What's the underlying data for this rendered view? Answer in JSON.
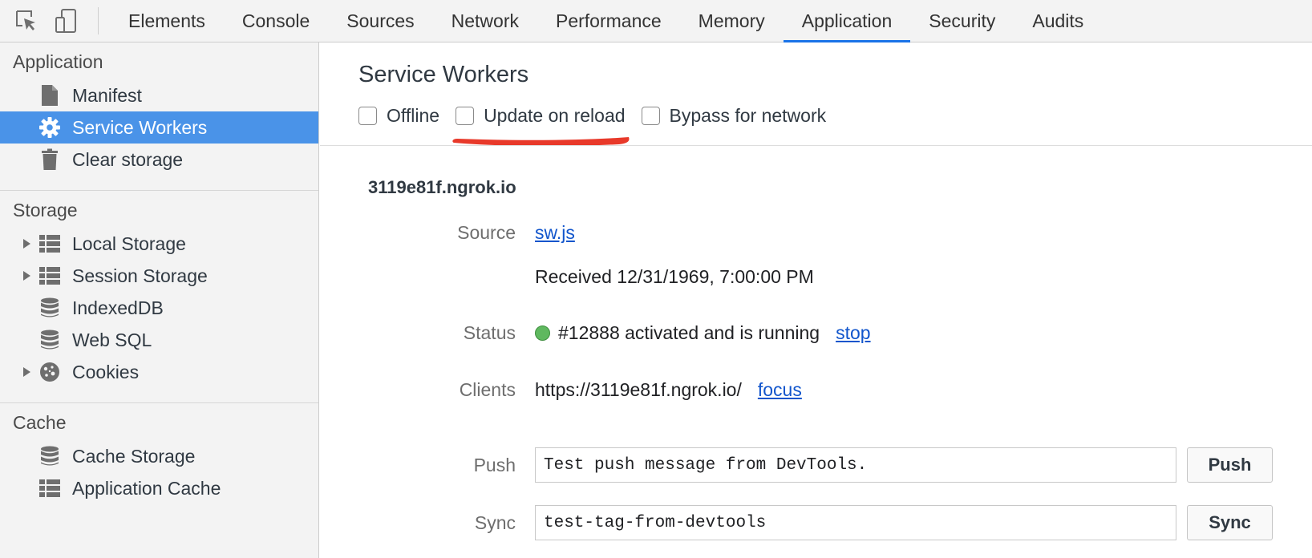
{
  "toolbar": {
    "icons": {
      "inspect": "inspect-element-icon",
      "device": "device-toolbar-icon"
    },
    "tabs": [
      {
        "label": "Elements"
      },
      {
        "label": "Console"
      },
      {
        "label": "Sources"
      },
      {
        "label": "Network"
      },
      {
        "label": "Performance"
      },
      {
        "label": "Memory"
      },
      {
        "label": "Application",
        "active": true
      },
      {
        "label": "Security"
      },
      {
        "label": "Audits"
      }
    ],
    "accent": "#1a73e8"
  },
  "sidebar": {
    "sections": [
      {
        "title": "Application",
        "items": [
          {
            "label": "Manifest",
            "icon": "document-icon"
          },
          {
            "label": "Service Workers",
            "icon": "gear-icon",
            "selected": true
          },
          {
            "label": "Clear storage",
            "icon": "trash-icon"
          }
        ]
      },
      {
        "title": "Storage",
        "items": [
          {
            "label": "Local Storage",
            "icon": "table-icon",
            "expandable": true
          },
          {
            "label": "Session Storage",
            "icon": "table-icon",
            "expandable": true
          },
          {
            "label": "IndexedDB",
            "icon": "database-icon"
          },
          {
            "label": "Web SQL",
            "icon": "database-icon"
          },
          {
            "label": "Cookies",
            "icon": "cookie-icon",
            "expandable": true
          }
        ]
      },
      {
        "title": "Cache",
        "items": [
          {
            "label": "Cache Storage",
            "icon": "database-icon"
          },
          {
            "label": "Application Cache",
            "icon": "table-icon"
          }
        ]
      }
    ],
    "selected_color": "#4a93e8"
  },
  "main": {
    "title": "Service Workers",
    "options": [
      {
        "label": "Offline",
        "checked": false
      },
      {
        "label": "Update on reload",
        "checked": false
      },
      {
        "label": "Bypass for network",
        "checked": false
      }
    ],
    "annotation_color": "#e8392a",
    "origin": "3119e81f.ngrok.io",
    "source": {
      "label": "Source",
      "link": "sw.js",
      "received": "Received 12/31/1969, 7:00:00 PM"
    },
    "status": {
      "label": "Status",
      "text": "#12888 activated and is running",
      "action": "stop",
      "dot_color": "#5fb85f"
    },
    "clients": {
      "label": "Clients",
      "url": "https://3119e81f.ngrok.io/",
      "action": "focus"
    },
    "push": {
      "label": "Push",
      "value": "Test push message from DevTools.",
      "button": "Push"
    },
    "sync": {
      "label": "Sync",
      "value": "test-tag-from-devtools",
      "button": "Sync"
    }
  }
}
